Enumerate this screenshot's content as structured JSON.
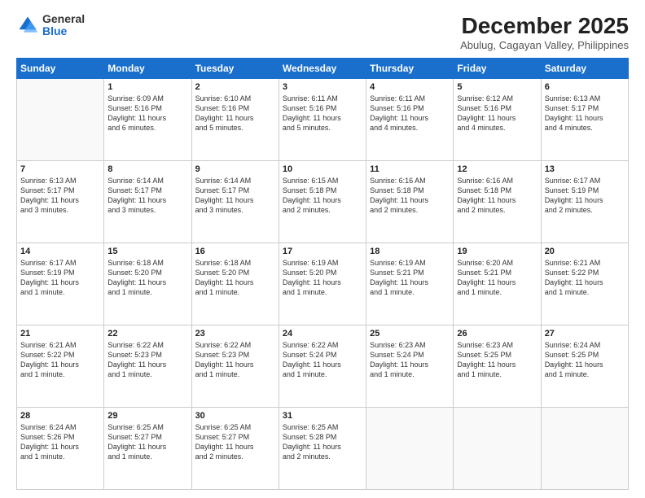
{
  "logo": {
    "general": "General",
    "blue": "Blue"
  },
  "title": "December 2025",
  "subtitle": "Abulug, Cagayan Valley, Philippines",
  "days_header": [
    "Sunday",
    "Monday",
    "Tuesday",
    "Wednesday",
    "Thursday",
    "Friday",
    "Saturday"
  ],
  "weeks": [
    [
      {
        "day": "",
        "text": ""
      },
      {
        "day": "1",
        "text": "Sunrise: 6:09 AM\nSunset: 5:16 PM\nDaylight: 11 hours\nand 6 minutes."
      },
      {
        "day": "2",
        "text": "Sunrise: 6:10 AM\nSunset: 5:16 PM\nDaylight: 11 hours\nand 5 minutes."
      },
      {
        "day": "3",
        "text": "Sunrise: 6:11 AM\nSunset: 5:16 PM\nDaylight: 11 hours\nand 5 minutes."
      },
      {
        "day": "4",
        "text": "Sunrise: 6:11 AM\nSunset: 5:16 PM\nDaylight: 11 hours\nand 4 minutes."
      },
      {
        "day": "5",
        "text": "Sunrise: 6:12 AM\nSunset: 5:16 PM\nDaylight: 11 hours\nand 4 minutes."
      },
      {
        "day": "6",
        "text": "Sunrise: 6:13 AM\nSunset: 5:17 PM\nDaylight: 11 hours\nand 4 minutes."
      }
    ],
    [
      {
        "day": "7",
        "text": "Sunrise: 6:13 AM\nSunset: 5:17 PM\nDaylight: 11 hours\nand 3 minutes."
      },
      {
        "day": "8",
        "text": "Sunrise: 6:14 AM\nSunset: 5:17 PM\nDaylight: 11 hours\nand 3 minutes."
      },
      {
        "day": "9",
        "text": "Sunrise: 6:14 AM\nSunset: 5:17 PM\nDaylight: 11 hours\nand 3 minutes."
      },
      {
        "day": "10",
        "text": "Sunrise: 6:15 AM\nSunset: 5:18 PM\nDaylight: 11 hours\nand 2 minutes."
      },
      {
        "day": "11",
        "text": "Sunrise: 6:16 AM\nSunset: 5:18 PM\nDaylight: 11 hours\nand 2 minutes."
      },
      {
        "day": "12",
        "text": "Sunrise: 6:16 AM\nSunset: 5:18 PM\nDaylight: 11 hours\nand 2 minutes."
      },
      {
        "day": "13",
        "text": "Sunrise: 6:17 AM\nSunset: 5:19 PM\nDaylight: 11 hours\nand 2 minutes."
      }
    ],
    [
      {
        "day": "14",
        "text": "Sunrise: 6:17 AM\nSunset: 5:19 PM\nDaylight: 11 hours\nand 1 minute."
      },
      {
        "day": "15",
        "text": "Sunrise: 6:18 AM\nSunset: 5:20 PM\nDaylight: 11 hours\nand 1 minute."
      },
      {
        "day": "16",
        "text": "Sunrise: 6:18 AM\nSunset: 5:20 PM\nDaylight: 11 hours\nand 1 minute."
      },
      {
        "day": "17",
        "text": "Sunrise: 6:19 AM\nSunset: 5:20 PM\nDaylight: 11 hours\nand 1 minute."
      },
      {
        "day": "18",
        "text": "Sunrise: 6:19 AM\nSunset: 5:21 PM\nDaylight: 11 hours\nand 1 minute."
      },
      {
        "day": "19",
        "text": "Sunrise: 6:20 AM\nSunset: 5:21 PM\nDaylight: 11 hours\nand 1 minute."
      },
      {
        "day": "20",
        "text": "Sunrise: 6:21 AM\nSunset: 5:22 PM\nDaylight: 11 hours\nand 1 minute."
      }
    ],
    [
      {
        "day": "21",
        "text": "Sunrise: 6:21 AM\nSunset: 5:22 PM\nDaylight: 11 hours\nand 1 minute."
      },
      {
        "day": "22",
        "text": "Sunrise: 6:22 AM\nSunset: 5:23 PM\nDaylight: 11 hours\nand 1 minute."
      },
      {
        "day": "23",
        "text": "Sunrise: 6:22 AM\nSunset: 5:23 PM\nDaylight: 11 hours\nand 1 minute."
      },
      {
        "day": "24",
        "text": "Sunrise: 6:22 AM\nSunset: 5:24 PM\nDaylight: 11 hours\nand 1 minute."
      },
      {
        "day": "25",
        "text": "Sunrise: 6:23 AM\nSunset: 5:24 PM\nDaylight: 11 hours\nand 1 minute."
      },
      {
        "day": "26",
        "text": "Sunrise: 6:23 AM\nSunset: 5:25 PM\nDaylight: 11 hours\nand 1 minute."
      },
      {
        "day": "27",
        "text": "Sunrise: 6:24 AM\nSunset: 5:25 PM\nDaylight: 11 hours\nand 1 minute."
      }
    ],
    [
      {
        "day": "28",
        "text": "Sunrise: 6:24 AM\nSunset: 5:26 PM\nDaylight: 11 hours\nand 1 minute."
      },
      {
        "day": "29",
        "text": "Sunrise: 6:25 AM\nSunset: 5:27 PM\nDaylight: 11 hours\nand 1 minute."
      },
      {
        "day": "30",
        "text": "Sunrise: 6:25 AM\nSunset: 5:27 PM\nDaylight: 11 hours\nand 2 minutes."
      },
      {
        "day": "31",
        "text": "Sunrise: 6:25 AM\nSunset: 5:28 PM\nDaylight: 11 hours\nand 2 minutes."
      },
      {
        "day": "",
        "text": ""
      },
      {
        "day": "",
        "text": ""
      },
      {
        "day": "",
        "text": ""
      }
    ]
  ]
}
